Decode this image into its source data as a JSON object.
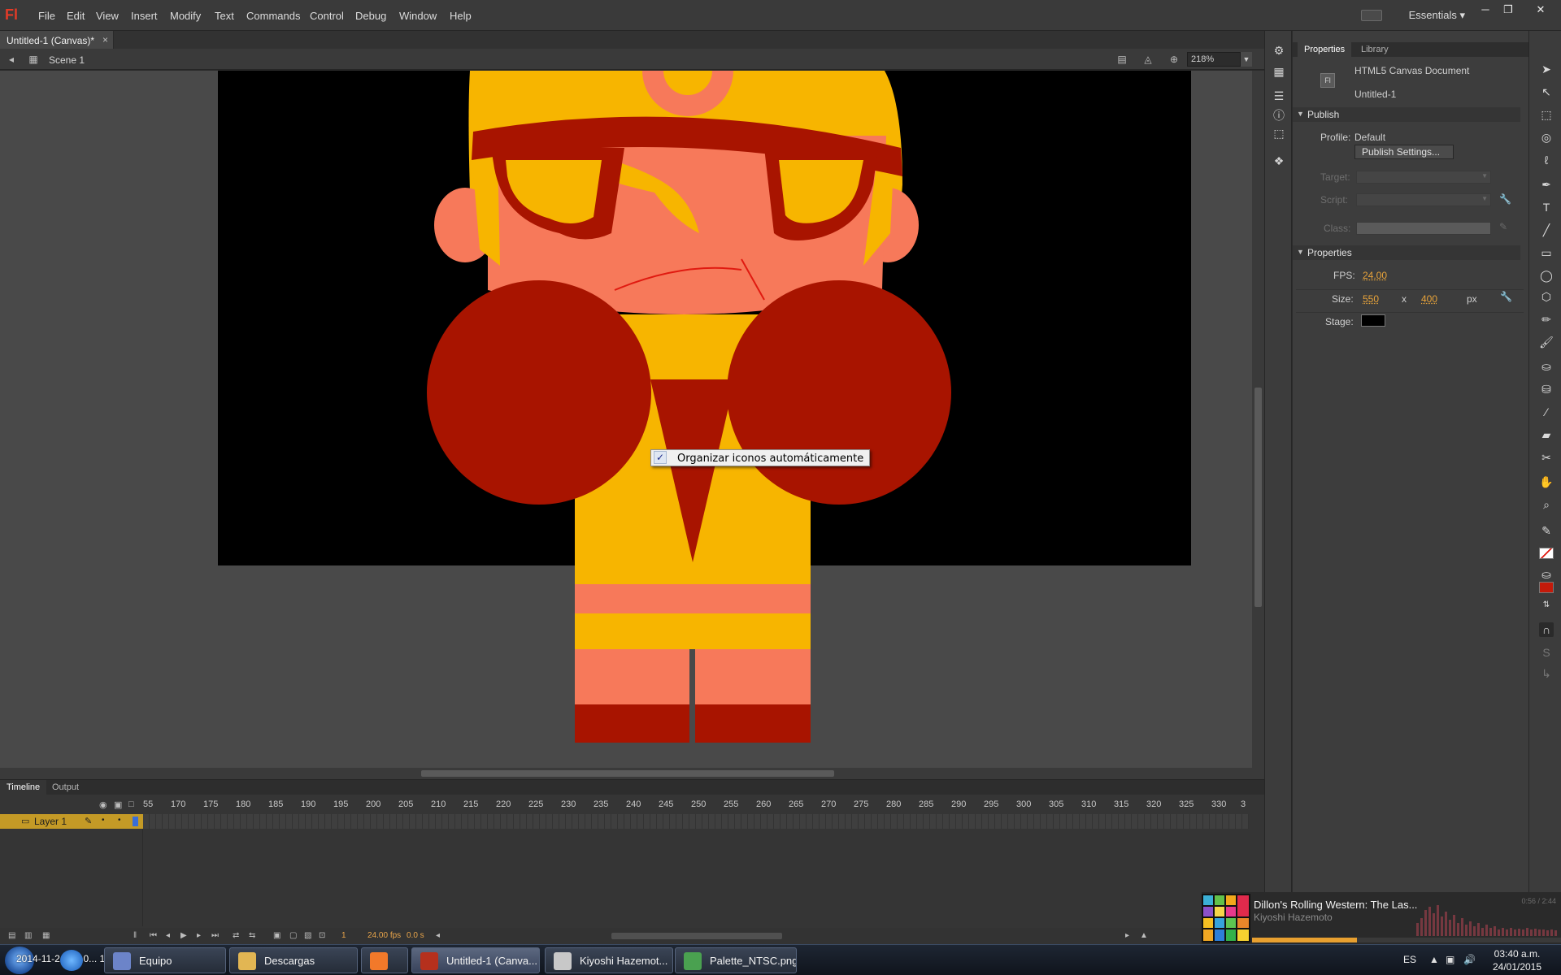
{
  "app": {
    "logo": "Fl"
  },
  "menu": [
    "File",
    "Edit",
    "View",
    "Insert",
    "Modify",
    "Text",
    "Commands",
    "Control",
    "Debug",
    "Window",
    "Help"
  ],
  "workspace": "Essentials",
  "window_buttons": {
    "minimize": "─",
    "restore": "❐",
    "close": "✕"
  },
  "document_tab": {
    "title": "Untitled-1 (Canvas)*",
    "close": "×"
  },
  "editbar": {
    "scene": "Scene 1",
    "zoom": "218%"
  },
  "context_menu": {
    "checked": true,
    "check_glyph": "✓",
    "label": "Organizar iconos automáticamente"
  },
  "timeline": {
    "tabs": [
      "Timeline",
      "Output"
    ],
    "ruler_first": "55",
    "ruler": [
      "170",
      "175",
      "180",
      "185",
      "190",
      "195",
      "200",
      "205",
      "210",
      "215",
      "220",
      "225",
      "230",
      "235",
      "240",
      "245",
      "250",
      "255",
      "260",
      "265",
      "270",
      "275",
      "280",
      "285",
      "290",
      "295",
      "300",
      "305",
      "310",
      "315",
      "320",
      "325",
      "330"
    ],
    "ruler_last": "3",
    "layer_name": "Layer 1",
    "status": {
      "frame": "1",
      "fps": "24.00",
      "fps_unit": "fps",
      "time": "0.0 s"
    }
  },
  "properties": {
    "tabs": [
      "Properties",
      "Library"
    ],
    "doc_type": "HTML5 Canvas Document",
    "doc_name": "Untitled-1",
    "doc_icon": "Fl",
    "publish": {
      "header": "Publish",
      "profile_label": "Profile:",
      "profile_value": "Default",
      "settings_button": "Publish Settings...",
      "target_label": "Target:",
      "script_label": "Script:",
      "class_label": "Class:"
    },
    "props": {
      "header": "Properties",
      "fps_label": "FPS:",
      "fps_value": "24.00",
      "size_label": "Size:",
      "width": "550",
      "x": "x",
      "height": "400",
      "unit": "px",
      "stage_label": "Stage:",
      "stage_color": "#000000"
    }
  },
  "player": {
    "title": "Dillon's Rolling Western: The Las...",
    "artist": "Kiyoshi Hazemoto",
    "time": "0:56 / 2:44",
    "progress": 0.34
  },
  "taskbar": {
    "overlay_text": "2014-11-2... fis 0... 10:36",
    "tasks": [
      {
        "label": "Equipo",
        "color": "#6c84c9",
        "active": false
      },
      {
        "label": "Descargas",
        "color": "#e2b653",
        "active": false
      },
      {
        "label": "",
        "color": "#f2792a",
        "active": false
      },
      {
        "label": "Untitled-1 (Canva...",
        "color": "#b5301d",
        "active": true
      },
      {
        "label": "Kiyoshi Hazemot...",
        "color": "#c8c8c8",
        "active": false
      },
      {
        "label": "Palette_NTSC.png...",
        "color": "#4aa150",
        "active": false
      }
    ],
    "lang": "ES",
    "clock_time": "03:40 a.m.",
    "clock_date": "24/01/2015"
  },
  "colors": {
    "hair": "#f7b500",
    "skin": "#f7795a",
    "dark_red": "#a81400",
    "accent_red": "#e01a10",
    "fill_swatch": "#c41a0a",
    "layer_highlight": "#c49a26"
  }
}
